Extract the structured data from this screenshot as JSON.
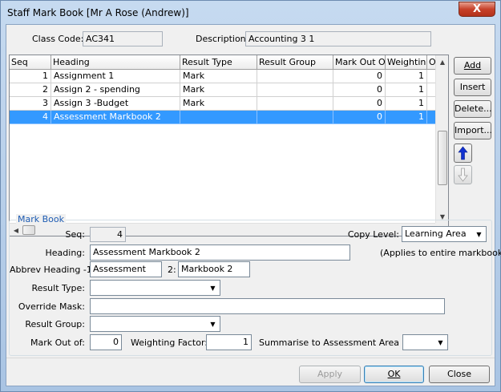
{
  "window": {
    "title": "Staff Mark Book [Mr A Rose (Andrew)]",
    "close_glyph": "X"
  },
  "header": {
    "class_code_label": "Class Code:",
    "class_code_value": "AC341",
    "description_label": "Description:",
    "description_value": "Accounting 3 1"
  },
  "grid": {
    "columns": [
      "Seq",
      "Heading",
      "Result Type",
      "Result Group",
      "Mark Out Of",
      "Weighting",
      "O"
    ],
    "rows": [
      {
        "seq": "1",
        "heading": "Assignment 1",
        "result_type": "Mark",
        "result_group": "",
        "mark_out_of": "0",
        "weighting": "1"
      },
      {
        "seq": "2",
        "heading": "Assign 2 - spending",
        "result_type": "Mark",
        "result_group": "",
        "mark_out_of": "0",
        "weighting": "1"
      },
      {
        "seq": "3",
        "heading": "Assign 3 -Budget",
        "result_type": "Mark",
        "result_group": "",
        "mark_out_of": "0",
        "weighting": "1"
      },
      {
        "seq": "4",
        "heading": "Assessment Markbook 2",
        "result_type": "",
        "result_group": "",
        "mark_out_of": "0",
        "weighting": "1"
      }
    ],
    "selected_row": 3
  },
  "side_buttons": {
    "add": "Add",
    "insert": "Insert",
    "delete": "Delete...",
    "import": "Import..."
  },
  "markbook": {
    "legend": "Mark Book",
    "seq_label": "Seq:",
    "seq_value": "4",
    "copy_level_label": "Copy Level:",
    "copy_level_value": "Learning Area",
    "heading_label": "Heading:",
    "heading_value": "Assessment Markbook 2",
    "applies_note": "(Applies to entire markbook)",
    "abbrev_label": "Abbrev Heading -1:",
    "abbrev1_value": "Assessment",
    "abbrev2_label": "2:",
    "abbrev2_value": "Markbook 2",
    "result_type_label": "Result Type:",
    "result_type_value": "",
    "override_mask_label": "Override Mask:",
    "override_mask_value": "",
    "result_group_label": "Result Group:",
    "result_group_value": "",
    "mark_out_of_label": "Mark Out of:",
    "mark_out_of_value": "0",
    "weighting_label": "Weighting Factor:",
    "weighting_value": "1",
    "summarise_label": "Summarise to Assessment Area Seq:",
    "summarise_value": ""
  },
  "footer": {
    "apply": "Apply",
    "ok": "OK",
    "close": "Close"
  }
}
